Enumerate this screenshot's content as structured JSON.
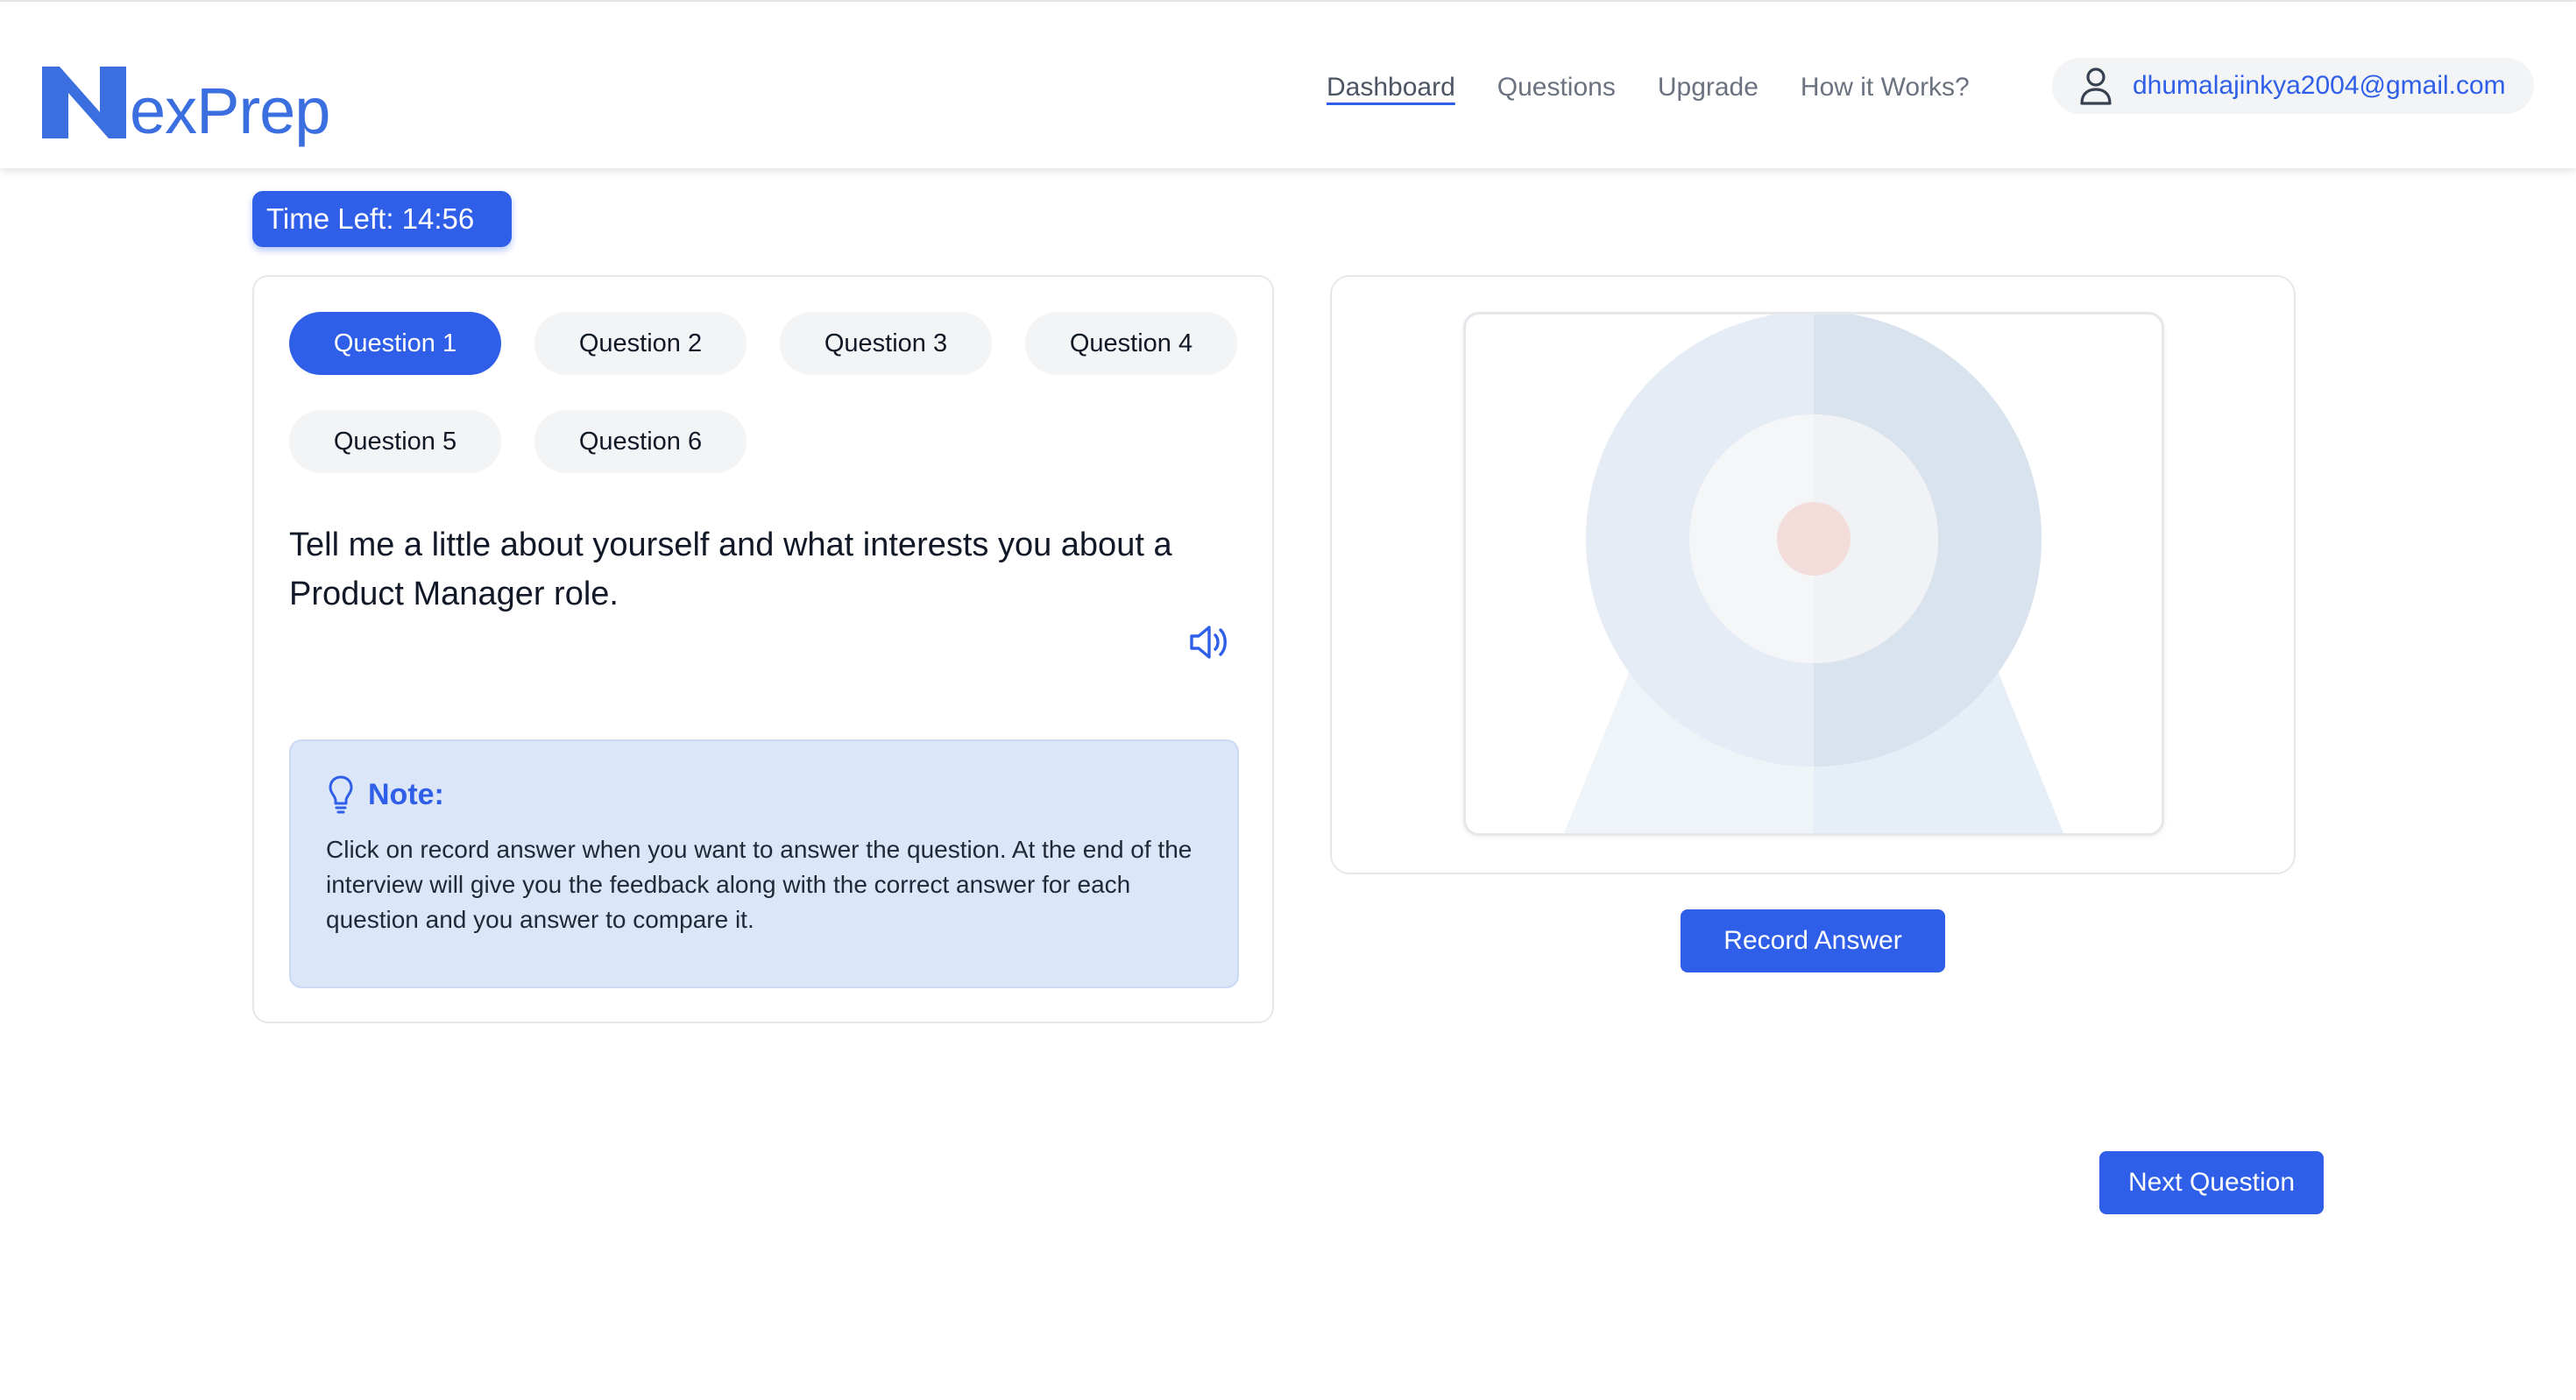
{
  "brand": {
    "logo_text": "exPrep"
  },
  "nav": {
    "items": [
      {
        "label": "Dashboard",
        "active": true
      },
      {
        "label": "Questions"
      },
      {
        "label": "Upgrade"
      },
      {
        "label": "How it Works?"
      }
    ],
    "user_email": "dhumalajinkya2004@gmail.com"
  },
  "timer": {
    "label": "Time Left: 14:56"
  },
  "questions": {
    "tabs": [
      {
        "label": "Question 1",
        "active": true
      },
      {
        "label": "Question 2"
      },
      {
        "label": "Question 3"
      },
      {
        "label": "Question 4"
      },
      {
        "label": "Question 5"
      },
      {
        "label": "Question 6"
      }
    ],
    "current_text": "Tell me a little about yourself and what interests you about a Product Manager role."
  },
  "note": {
    "title": "Note:",
    "body": "Click on record answer when you want to answer the question. At the end of the interview will give you the feedback along with the correct answer for each question and you answer to compare it."
  },
  "actions": {
    "record_label": "Record Answer",
    "next_label": "Next Question"
  },
  "colors": {
    "accent": "#2f5fe8",
    "note_bg": "#dbe6f8",
    "pill_bg": "#f3f4f6"
  }
}
